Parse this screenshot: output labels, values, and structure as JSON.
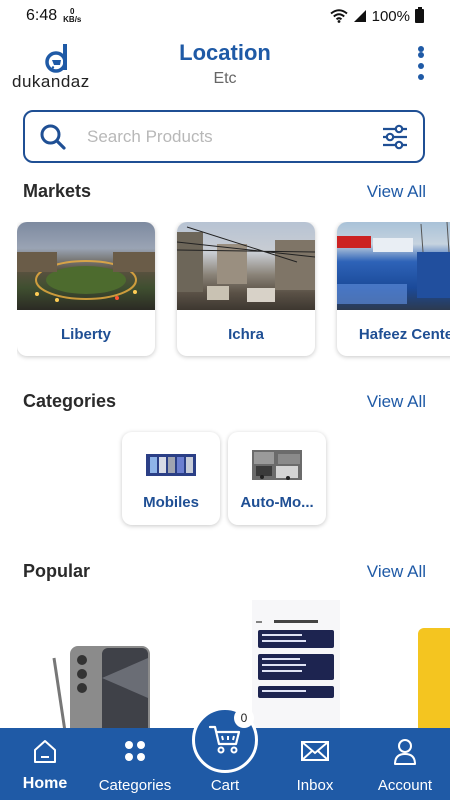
{
  "status_bar": {
    "time": "6:48",
    "net_speed_value": "0",
    "net_speed_unit": "KB/s",
    "battery": "100%"
  },
  "header": {
    "logo_text": "dukandaz",
    "title": "Location",
    "subtitle": "Etc"
  },
  "search": {
    "placeholder": "Search Products"
  },
  "markets": {
    "title": "Markets",
    "view_all": "View All",
    "items": [
      {
        "label": "Liberty"
      },
      {
        "label": "Ichra"
      },
      {
        "label": "Hafeez Cente"
      }
    ]
  },
  "categories": {
    "title": "Categories",
    "view_all": "View All",
    "items": [
      {
        "label": "Mobiles"
      },
      {
        "label": "Auto-Mo..."
      }
    ]
  },
  "popular": {
    "title": "Popular",
    "view_all": "View All"
  },
  "bottom_nav": {
    "items": [
      {
        "label": "Home",
        "icon": "home-icon",
        "active": true
      },
      {
        "label": "Categories",
        "icon": "grid-icon"
      },
      {
        "label": "Cart",
        "icon": "cart-icon"
      },
      {
        "label": "Inbox",
        "icon": "envelope-icon"
      },
      {
        "label": "Account",
        "icon": "user-icon"
      }
    ],
    "cart_count": "0"
  },
  "colors": {
    "brand": "#1f5aa6",
    "brand_dark": "#1f4f94",
    "notification": "#e01818"
  }
}
